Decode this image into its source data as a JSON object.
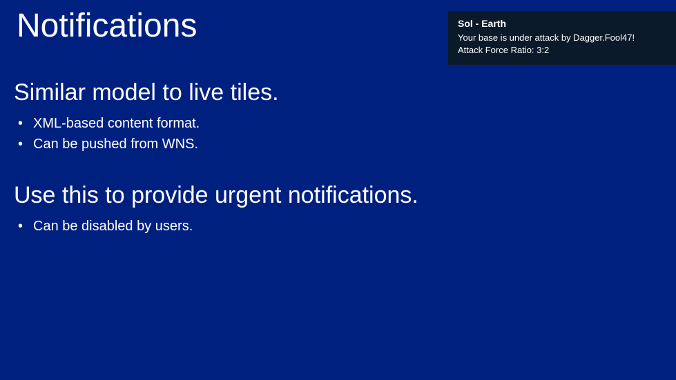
{
  "title": "Notifications",
  "sections": [
    {
      "heading": "Similar model to live tiles.",
      "bullets": [
        "XML-based content format.",
        "Can be pushed from WNS."
      ]
    },
    {
      "heading": "Use this to provide urgent notifications.",
      "bullets": [
        "Can be disabled by users."
      ]
    }
  ],
  "toast": {
    "title": "Sol - Earth",
    "line1": "Your base is under attack by Dagger.Fool47!",
    "line2": "Attack Force Ratio: 3:2"
  }
}
